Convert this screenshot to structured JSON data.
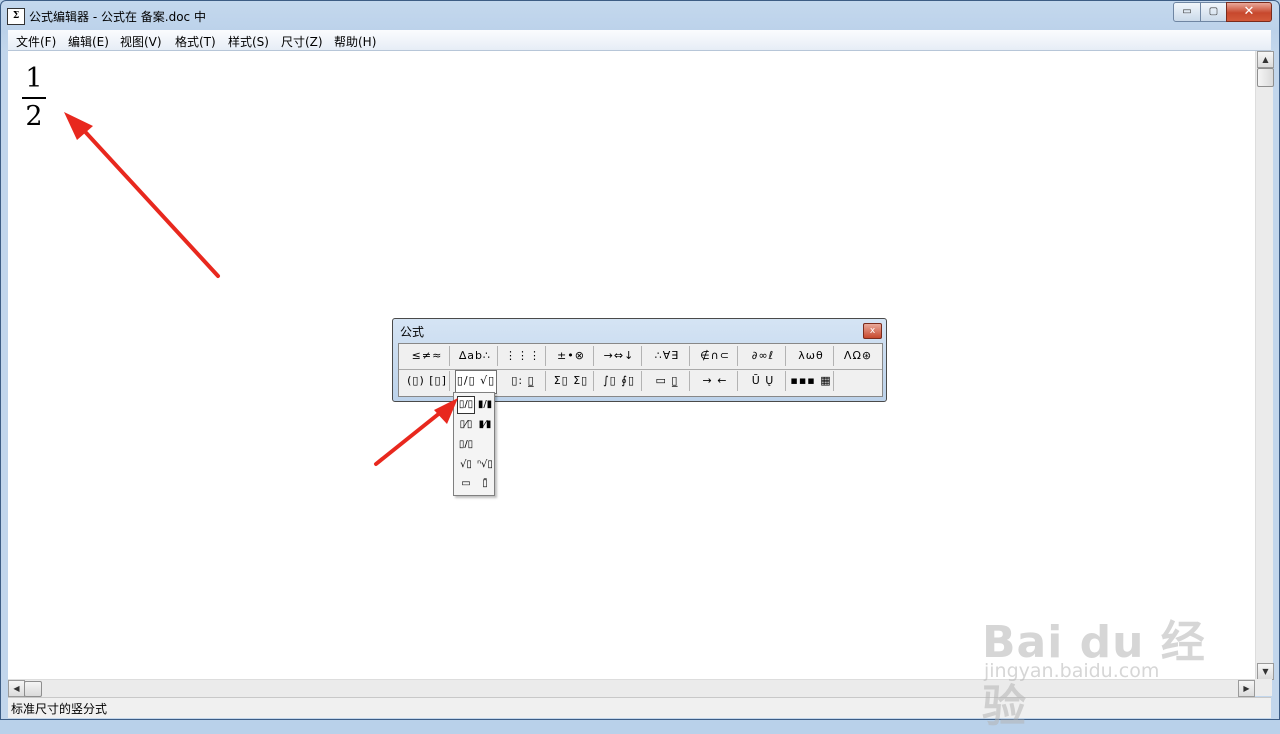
{
  "window": {
    "icon_text": "Σ",
    "title": "公式编辑器 - 公式在 备案.doc 中",
    "minimize": "▭",
    "maximize": "▢",
    "close": "✕"
  },
  "menu": [
    "文件(F)",
    "编辑(E)",
    "视图(V)",
    "格式(T)",
    "样式(S)",
    "尺寸(Z)",
    "帮助(H)"
  ],
  "equation": {
    "numerator": "1",
    "denominator": "2"
  },
  "palette": {
    "title": "公式",
    "close": "x",
    "row1": [
      "≤≠≈",
      "∆ab∴",
      "⋮⋮⋮",
      "±•⊗",
      "→⇔↓",
      "∴∀∃",
      "∉∩⊂",
      "∂∞ℓ",
      "λωθ",
      "ΛΩ⊛"
    ],
    "row2": [
      "(▯) [▯]",
      "▯/▯ √▯",
      "▯: ▯̲",
      "Σ▯ Σ▯",
      "∫▯ ∮▯",
      "▭ ▯̲",
      "→ ←",
      "Ū Ų",
      "▪▪▪ ▦",
      ""
    ]
  },
  "dropdown": {
    "items": [
      "▯/▯",
      "▮/▮",
      "▯⁄▯",
      "▮⁄▮",
      "▯/▯",
      "√▯",
      "ⁿ√▯",
      "▭",
      "▯̄"
    ]
  },
  "status": "标准尺寸的竖分式",
  "scroll": {
    "up": "▲",
    "down": "▼",
    "left": "◀",
    "right": "▶"
  },
  "watermark": {
    "main": "Bai du 经验",
    "sub": "jingyan.baidu.com"
  },
  "colors": {
    "arrow": "#e8281e",
    "titlebar": "#bcd2ea"
  }
}
